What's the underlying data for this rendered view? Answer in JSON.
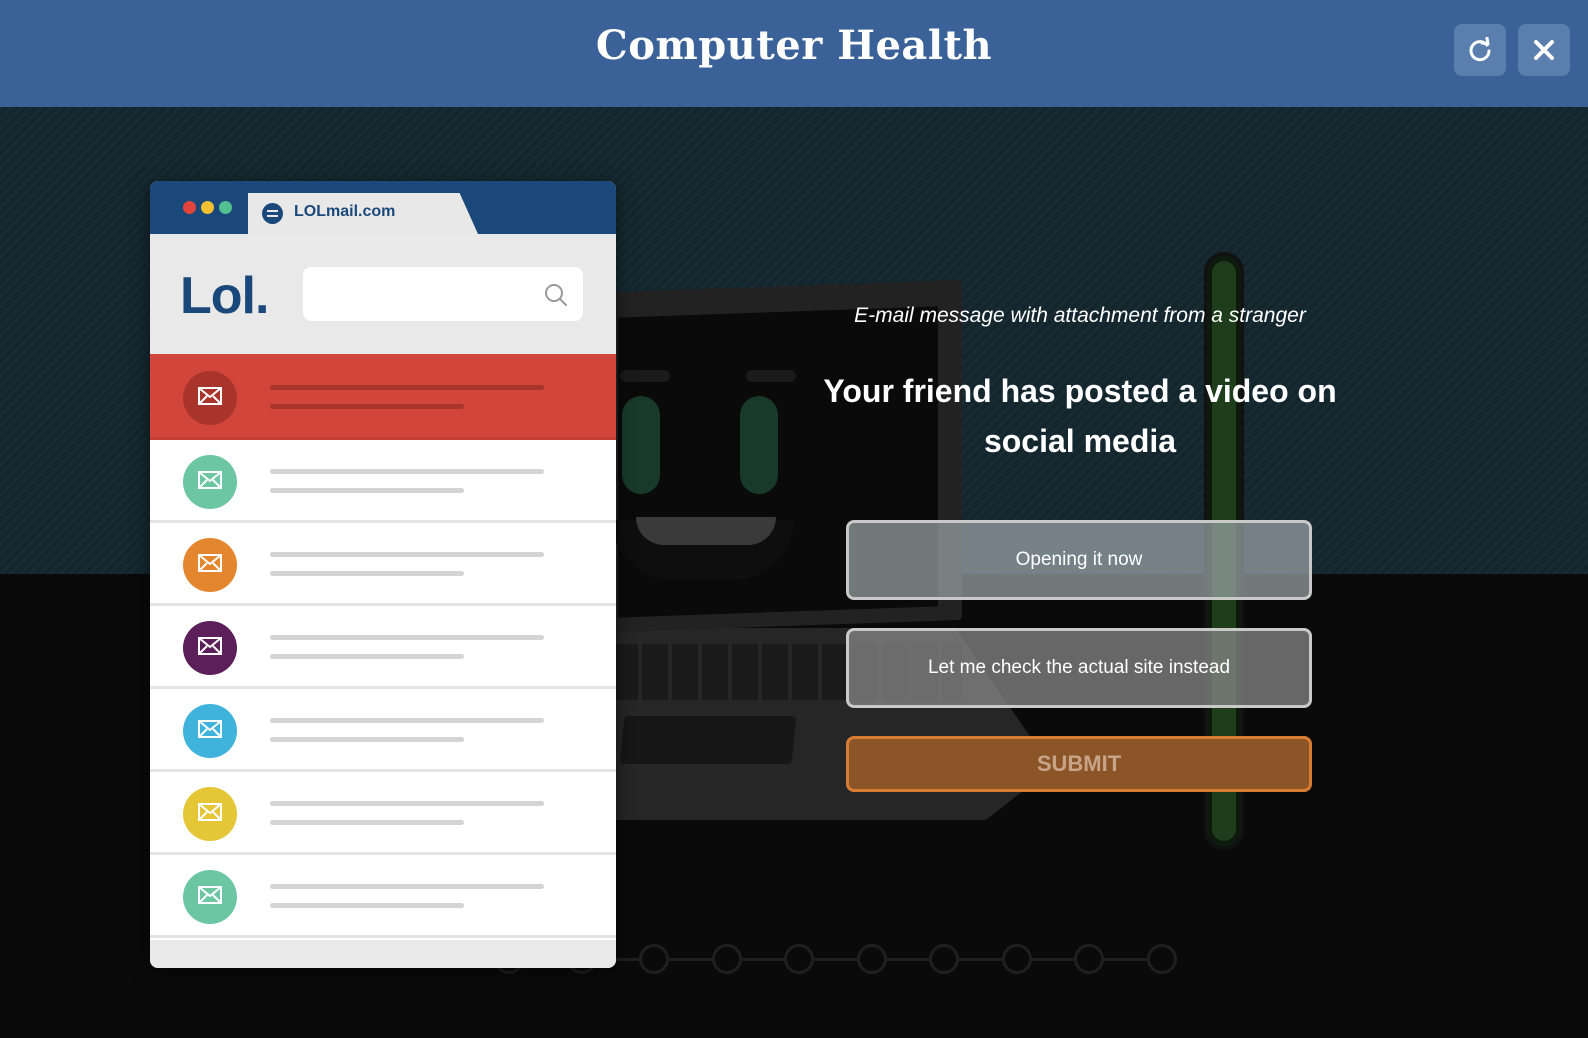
{
  "header": {
    "title": "Computer Health",
    "refresh_icon": "refresh-icon",
    "close_icon": "close-icon"
  },
  "mail_window": {
    "tab_label": "LOLmail.com",
    "logo": "Lol.",
    "search": {
      "value": "",
      "placeholder": ""
    },
    "window_dot_colors": [
      "#e0443a",
      "#f2c030",
      "#52c08e"
    ],
    "selected_row_color": "#d2453a",
    "rows": [
      {
        "avatar_color": "#a8342c",
        "selected": true
      },
      {
        "avatar_color": "#6cc6a3",
        "selected": false
      },
      {
        "avatar_color": "#e3862e",
        "selected": false
      },
      {
        "avatar_color": "#5c1f5a",
        "selected": false
      },
      {
        "avatar_color": "#3fb3dc",
        "selected": false
      },
      {
        "avatar_color": "#e4c637",
        "selected": false
      },
      {
        "avatar_color": "#6cc6a3",
        "selected": false
      }
    ]
  },
  "question": {
    "context": "E-mail message with attachment from a stranger",
    "text": "Your friend has posted a video on social media",
    "options": [
      {
        "label": "Opening it now"
      },
      {
        "label": "Let me check the actual site instead"
      }
    ],
    "submit_label": "SUBMIT"
  },
  "colors": {
    "header_bg": "#3a6298",
    "submit_border": "#d97c33",
    "submit_bg": "#8c5527",
    "meter_fill": "#1d3d1b"
  },
  "progress": {
    "total_steps": 10
  }
}
